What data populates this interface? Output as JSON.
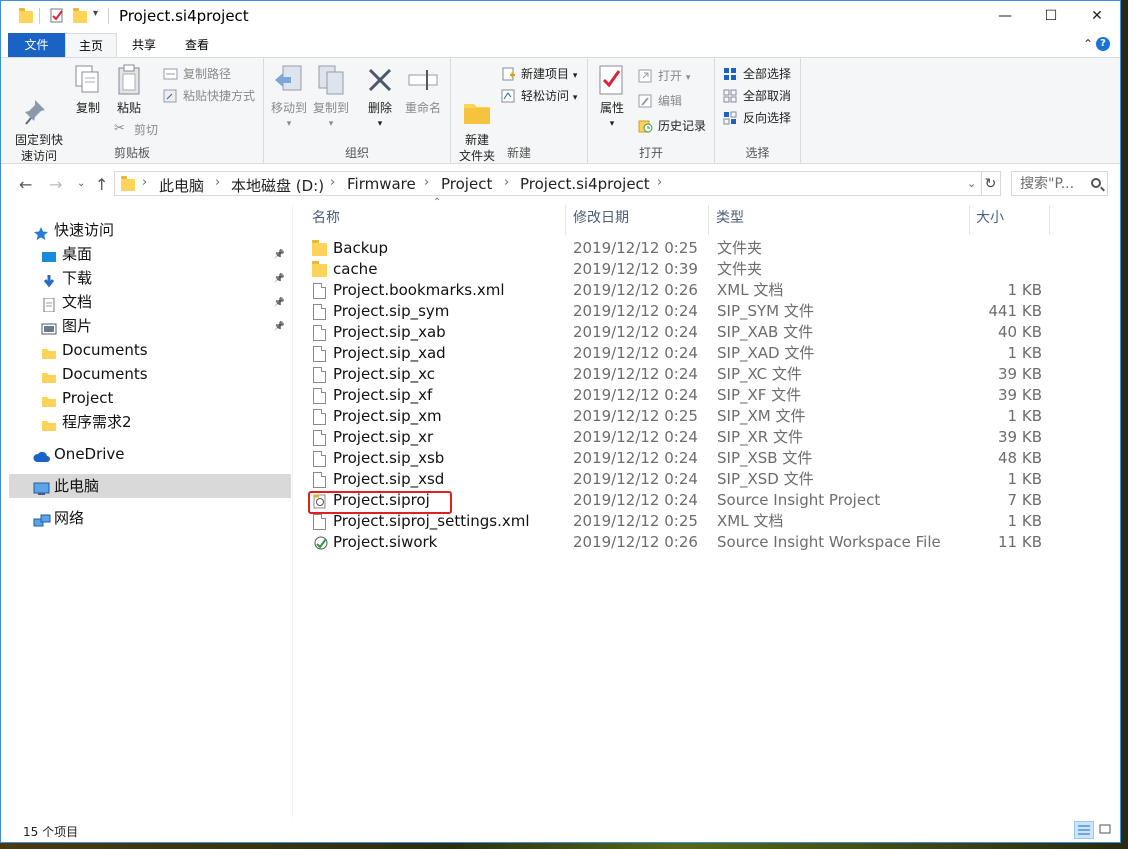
{
  "window": {
    "title": "Project.si4project"
  },
  "controls": {
    "minimize": "—",
    "maximize": "☐",
    "close": "✕"
  },
  "menu": {
    "file": "文件",
    "home": "主页",
    "share": "共享",
    "view": "查看"
  },
  "ribbon": {
    "clipboard": {
      "label": "剪贴板",
      "pin": "固定到快\n速访问",
      "copy": "复制",
      "paste": "粘贴",
      "copy_path": "复制路径",
      "paste_shortcut": "粘贴快捷方式",
      "cut": "剪切"
    },
    "organize": {
      "label": "组织",
      "move_to": "移动到",
      "copy_to": "复制到",
      "delete": "删除",
      "rename": "重命名"
    },
    "new": {
      "label": "新建",
      "new_folder": "新建\n文件夹",
      "new_item": "新建项目",
      "easy_access": "轻松访问"
    },
    "open": {
      "label": "打开",
      "properties": "属性",
      "open": "打开",
      "edit": "编辑",
      "history": "历史记录"
    },
    "select": {
      "label": "选择",
      "select_all": "全部选择",
      "select_none": "全部取消",
      "invert": "反向选择"
    }
  },
  "breadcrumb": [
    "此电脑",
    "本地磁盘 (D:)",
    "Firmware",
    "Project",
    "Project.si4project"
  ],
  "search": {
    "placeholder": "搜索\"P..."
  },
  "sidebar": [
    {
      "label": "快速访问",
      "icon": "star-icon",
      "pinned": false
    },
    {
      "label": "桌面",
      "icon": "desktop-icon",
      "pinned": true
    },
    {
      "label": "下载",
      "icon": "download-icon",
      "pinned": true
    },
    {
      "label": "文档",
      "icon": "document-icon",
      "pinned": true
    },
    {
      "label": "图片",
      "icon": "picture-icon",
      "pinned": true
    },
    {
      "label": "Documents",
      "icon": "folder-icon",
      "pinned": false
    },
    {
      "label": "Documents",
      "icon": "folder-icon",
      "pinned": false
    },
    {
      "label": "Project",
      "icon": "folder-icon",
      "pinned": false
    },
    {
      "label": "程序需求2",
      "icon": "folder-icon",
      "pinned": false
    },
    {
      "label": "OneDrive",
      "icon": "cloud-icon",
      "pinned": false
    },
    {
      "label": "此电脑",
      "icon": "computer-icon",
      "pinned": false,
      "selected": true
    },
    {
      "label": "网络",
      "icon": "network-icon",
      "pinned": false
    }
  ],
  "columns": {
    "name": "名称",
    "date": "修改日期",
    "type": "类型",
    "size": "大小"
  },
  "files": [
    {
      "name": "Backup",
      "date": "2019/12/12 0:25",
      "type": "文件夹",
      "size": "",
      "icon": "folder-icon"
    },
    {
      "name": "cache",
      "date": "2019/12/12 0:39",
      "type": "文件夹",
      "size": "",
      "icon": "folder-icon"
    },
    {
      "name": "Project.bookmarks.xml",
      "date": "2019/12/12 0:26",
      "type": "XML 文档",
      "size": "1 KB",
      "icon": "file-icon"
    },
    {
      "name": "Project.sip_sym",
      "date": "2019/12/12 0:24",
      "type": "SIP_SYM 文件",
      "size": "441 KB",
      "icon": "file-icon"
    },
    {
      "name": "Project.sip_xab",
      "date": "2019/12/12 0:24",
      "type": "SIP_XAB 文件",
      "size": "40 KB",
      "icon": "file-icon"
    },
    {
      "name": "Project.sip_xad",
      "date": "2019/12/12 0:24",
      "type": "SIP_XAD 文件",
      "size": "1 KB",
      "icon": "file-icon"
    },
    {
      "name": "Project.sip_xc",
      "date": "2019/12/12 0:24",
      "type": "SIP_XC 文件",
      "size": "39 KB",
      "icon": "file-icon"
    },
    {
      "name": "Project.sip_xf",
      "date": "2019/12/12 0:24",
      "type": "SIP_XF 文件",
      "size": "39 KB",
      "icon": "file-icon"
    },
    {
      "name": "Project.sip_xm",
      "date": "2019/12/12 0:25",
      "type": "SIP_XM 文件",
      "size": "1 KB",
      "icon": "file-icon"
    },
    {
      "name": "Project.sip_xr",
      "date": "2019/12/12 0:24",
      "type": "SIP_XR 文件",
      "size": "39 KB",
      "icon": "file-icon"
    },
    {
      "name": "Project.sip_xsb",
      "date": "2019/12/12 0:24",
      "type": "SIP_XSB 文件",
      "size": "48 KB",
      "icon": "file-icon"
    },
    {
      "name": "Project.sip_xsd",
      "date": "2019/12/12 0:24",
      "type": "SIP_XSD 文件",
      "size": "1 KB",
      "icon": "file-icon"
    },
    {
      "name": "Project.siproj",
      "date": "2019/12/12 0:24",
      "type": "Source Insight Project",
      "size": "7 KB",
      "icon": "siproj-icon"
    },
    {
      "name": "Project.siproj_settings.xml",
      "date": "2019/12/12 0:25",
      "type": "XML 文档",
      "size": "1 KB",
      "icon": "file-icon"
    },
    {
      "name": "Project.siwork",
      "date": "2019/12/12 0:26",
      "type": "Source Insight Workspace File",
      "size": "11 KB",
      "icon": "siwork-icon"
    }
  ],
  "status": {
    "count": "15 个项目"
  },
  "colors": {
    "accent": "#1a63c4",
    "highlight": "#e02020",
    "selected": "#d9d9d9"
  }
}
